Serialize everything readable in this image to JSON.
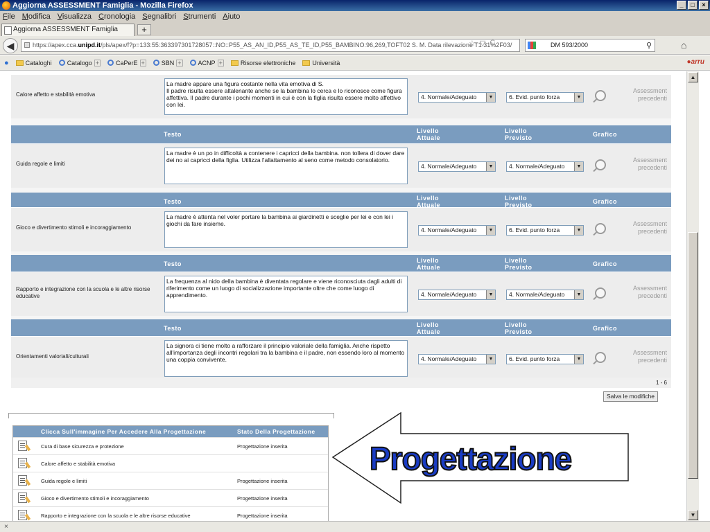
{
  "window": {
    "title": "Aggiorna ASSESSMENT Famiglia - Mozilla Firefox"
  },
  "menubar": [
    "File",
    "Modifica",
    "Visualizza",
    "Cronologia",
    "Segnalibri",
    "Strumenti",
    "Aiuto"
  ],
  "tab": {
    "title": "Aggiorna ASSESSMENT Famiglia",
    "new_tab": "+"
  },
  "nav": {
    "url_prefix": "https://apex.cca.",
    "url_domain": "unipd.it",
    "url_rest": "/pls/apex/f?p=133:55:363397301728057::NO::P55_AS_AN_ID,P55_AS_TE_ID,P55_BAMBINO:96,269,TOFT02 S. M. Data rilevazione T1  31%2F03/",
    "search_value": "DM 593/2000"
  },
  "bookmarks": [
    "Cataloghi",
    "Catalogo",
    "CaPerE",
    "SBN",
    "ACNP",
    "Risorse elettroniche",
    "Università"
  ],
  "columns": {
    "testo": "Testo",
    "attuale": "Livello Attuale",
    "previsto": "Livello Previsto",
    "grafico": "Grafico"
  },
  "prev_link": "Assessment precedenti",
  "rows": [
    {
      "label": "Calore affetto e stabilità emotiva",
      "text": "La madre appare una figura costante nella vita emotiva di S.\nIl padre risulta essere altalenante anche se la bambina lo cerca e lo riconosce come figura affettiva. Il padre durante i pochi momenti in cui è con la figlia risulta essere molto affettivo con lei.",
      "attuale": "4. Normale/Adeguato",
      "previsto": "6. Evid. punto forza"
    },
    {
      "label": "Guida regole e limiti",
      "text": "La madre è un po in difficoltà a contenere i capricci della bambina. non tollera di dover dare dei no ai capricci della figlia. Utilizza l'allattamento al seno come metodo consolatorio.",
      "attuale": "4. Normale/Adeguato",
      "previsto": "4. Normale/Adeguato"
    },
    {
      "label": "Gioco e divertimento stimoli e incoraggiamento",
      "text": "La madre è attenta nel voler portare la bambina ai giardinetti e sceglie per lei e con lei i giochi da fare insieme.",
      "attuale": "4. Normale/Adeguato",
      "previsto": "6. Evid. punto forza"
    },
    {
      "label": "Rapporto e integrazione con la scuola e le altre risorse educative",
      "text": "La frequenza al nido della bambina è diventata regolare e viene riconosciuta dagli adulti di riferimento come un luogo di socializzazione importante oltre che come luogo di apprendimento.",
      "attuale": "4. Normale/Adeguato",
      "previsto": "4. Normale/Adeguato"
    },
    {
      "label": "Orientamenti valoriali/culturali",
      "text": "La signora ci tiene molto a rafforzare il principio valoriale della famiglia. Anche rispetto all'importanza degli incontri regolari tra la bambina e il padre, non essendo loro al momento una coppia convivente.",
      "attuale": "4. Normale/Adeguato",
      "previsto": "6. Evid. punto forza"
    }
  ],
  "pagination": "1 - 6",
  "save_button": "Salva le modifiche",
  "progettazione": {
    "col1": "Clicca Sull'immagine Per Accedere Alla Progettazione",
    "col2": "Stato Della Progettazione",
    "items": [
      {
        "name": "Cura di base sicurezza e protezione",
        "status": "Progettazione inserita"
      },
      {
        "name": "Calore affetto e stabilità emotiva",
        "status": ""
      },
      {
        "name": "Guida regole e limiti",
        "status": "Progettazione inserita"
      },
      {
        "name": "Gioco e divertimento stimoli e incoraggiamento",
        "status": "Progettazione inserita"
      },
      {
        "name": "Rapporto e integrazione con la scuola e le altre risorse educative",
        "status": "Progettazione inserita"
      }
    ]
  },
  "overlay_word": "Progettazione",
  "colors": {
    "header": "#7a9cbf",
    "row_bg": "#ededed",
    "overlay_text": "#1a3cc4"
  },
  "status_text": "×"
}
